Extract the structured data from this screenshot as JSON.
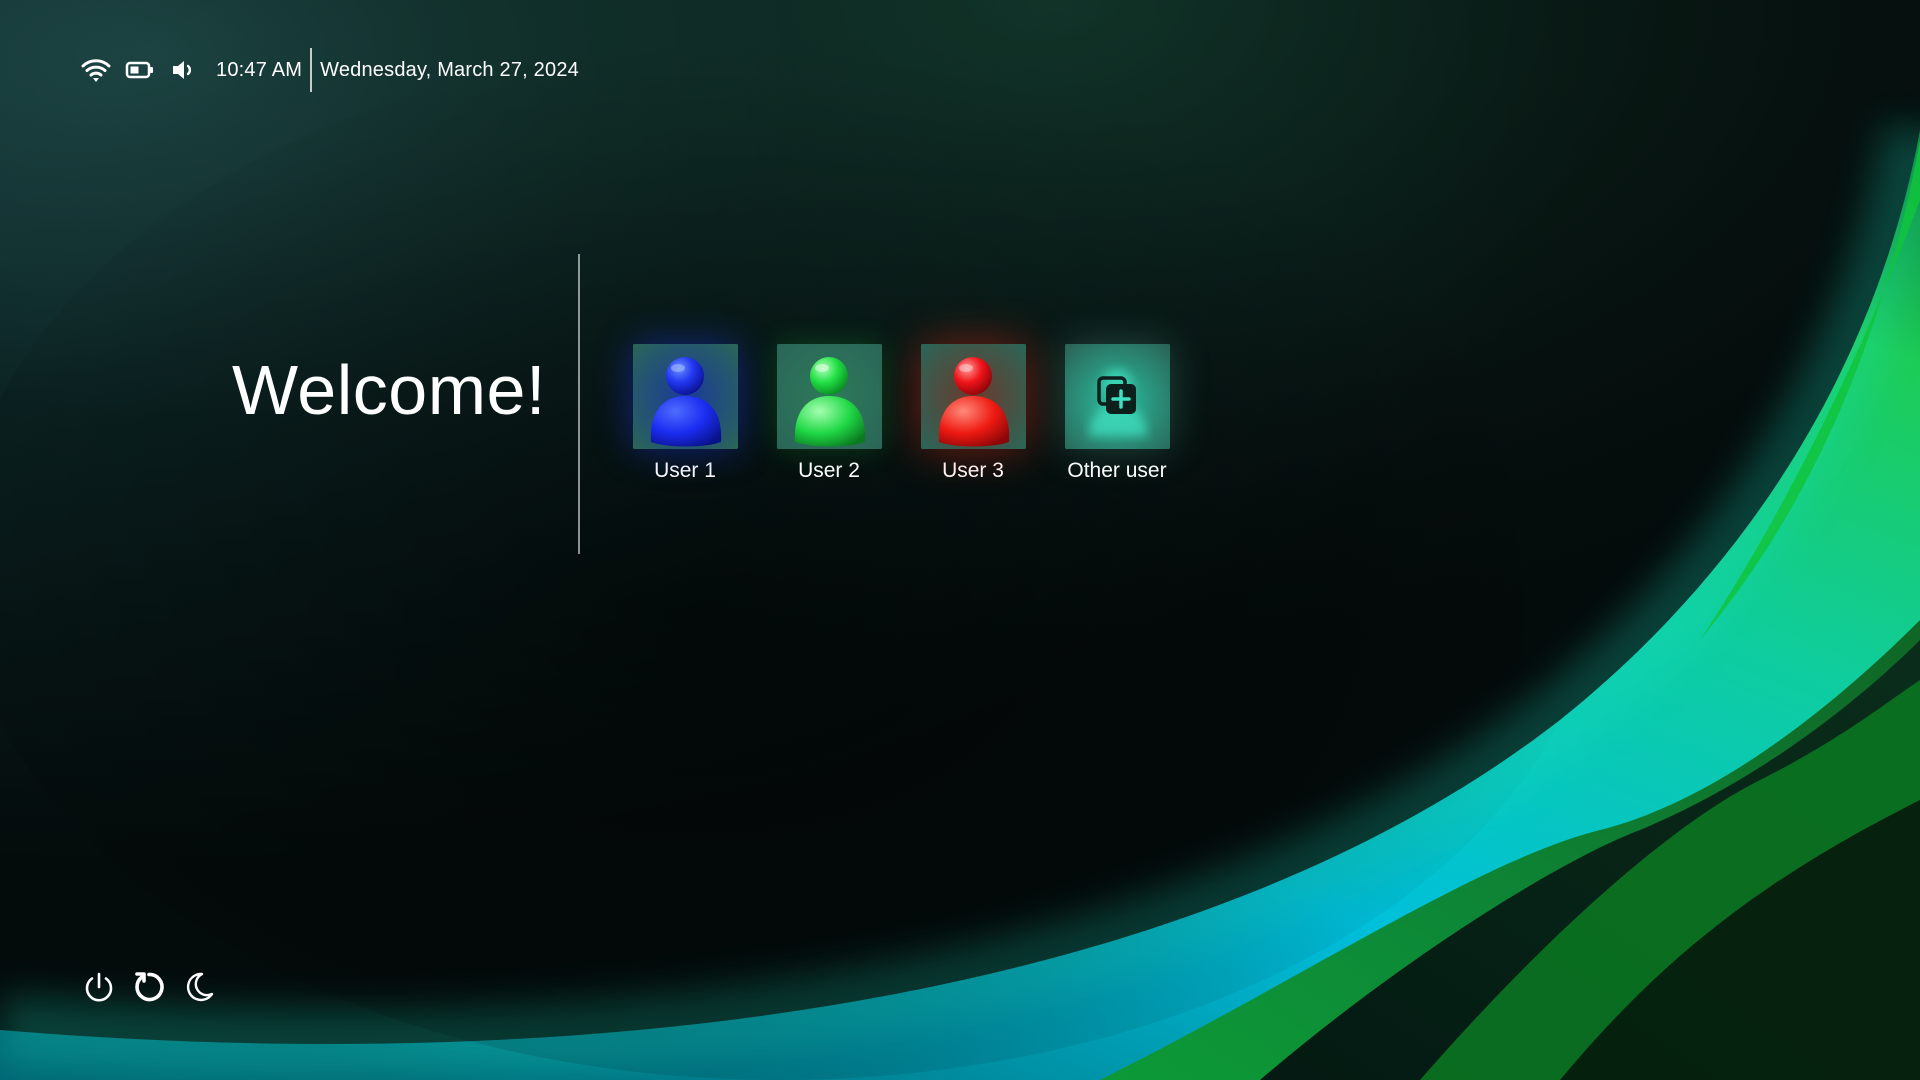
{
  "status_bar": {
    "icons": [
      "wifi-icon",
      "battery-icon",
      "volume-icon"
    ],
    "time": "10:47 AM",
    "date": "Wednesday, March 27, 2024"
  },
  "welcome": {
    "title": "Welcome!"
  },
  "users": [
    {
      "name": "User 1",
      "color": "#1a2eff",
      "icon": "user-avatar-blue"
    },
    {
      "name": "User 2",
      "color": "#1ee84a",
      "icon": "user-avatar-green"
    },
    {
      "name": "User 3",
      "color": "#ff1e14",
      "icon": "user-avatar-red"
    },
    {
      "name": "Other user",
      "color": "#2f6a60",
      "icon": "add-user-icon"
    }
  ],
  "power_controls": [
    "power-icon",
    "restart-icon",
    "sleep-icon"
  ],
  "theme": {
    "accent_teal": "#00c8e0",
    "accent_green": "#14c84a",
    "background_dark": "#05100f"
  }
}
